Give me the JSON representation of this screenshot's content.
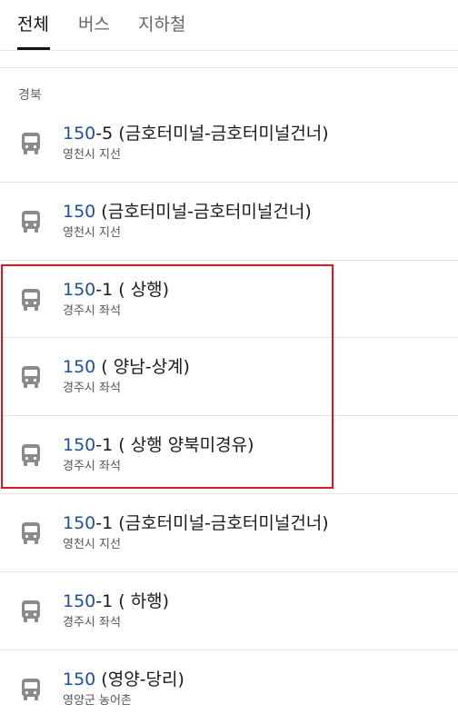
{
  "tabs": [
    {
      "label": "전체",
      "active": true
    },
    {
      "label": "버스",
      "active": false
    },
    {
      "label": "지하철",
      "active": false
    }
  ],
  "section_label": "경북",
  "results": [
    {
      "number": "150",
      "suffix": "-5 (금호터미널-금호터미널건너)",
      "subtitle": "영천시 지선"
    },
    {
      "number": "150",
      "suffix": " (금호터미널-금호터미널건너)",
      "subtitle": "영천시 지선"
    },
    {
      "number": "150",
      "suffix": "-1 ( 상행)",
      "subtitle": "경주시 좌석"
    },
    {
      "number": "150",
      "suffix": " ( 양남-상계)",
      "subtitle": "경주시 좌석"
    },
    {
      "number": "150",
      "suffix": "-1 ( 상행 양북미경유)",
      "subtitle": "경주시 좌석"
    },
    {
      "number": "150",
      "suffix": "-1 (금호터미널-금호터미널건너)",
      "subtitle": "영천시 지선"
    },
    {
      "number": "150",
      "suffix": "-1 ( 하행)",
      "subtitle": "경주시 좌석"
    },
    {
      "number": "150",
      "suffix": " (영양-당리)",
      "subtitle": "영양군 농어촌"
    }
  ],
  "icon": "bus-icon",
  "colors": {
    "route_number": "#1f4fa0",
    "highlight": "#e3141b",
    "icon": "#8a8a8a"
  }
}
